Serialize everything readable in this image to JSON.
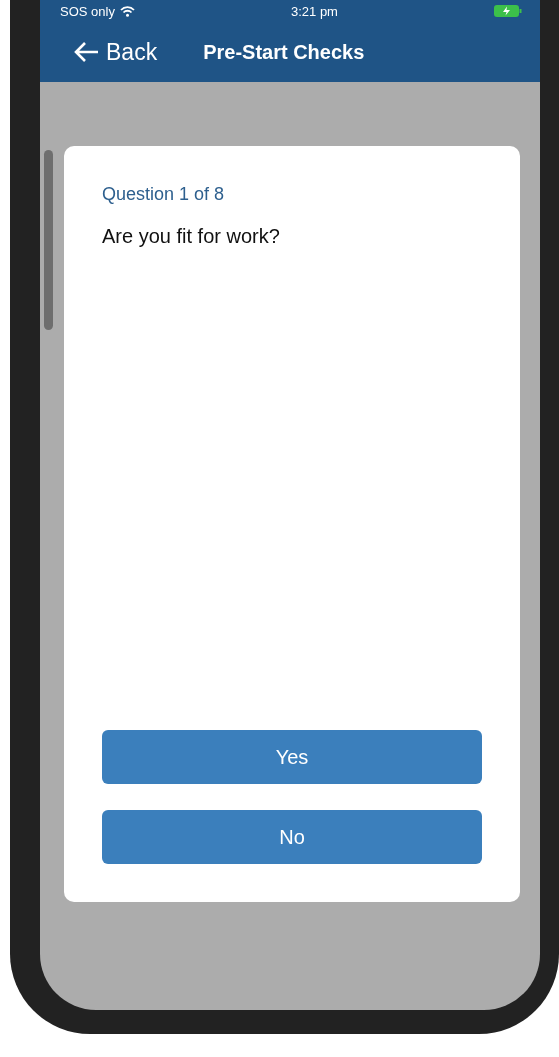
{
  "status_bar": {
    "carrier": "SOS only",
    "time": "3:21 pm"
  },
  "header": {
    "back_label": "Back",
    "title": "Pre-Start Checks"
  },
  "question": {
    "counter": "Question 1 of 8",
    "text": "Are you fit for work?"
  },
  "answers": [
    {
      "label": "Yes"
    },
    {
      "label": "No"
    }
  ]
}
